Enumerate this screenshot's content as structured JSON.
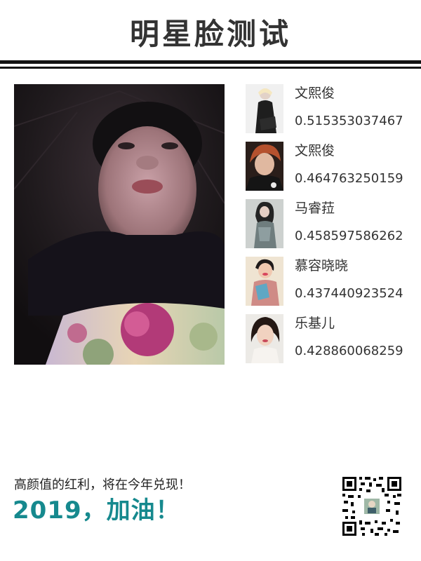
{
  "header": {
    "title": "明星脸测试"
  },
  "user_photo": {
    "icon": "user-face-photo"
  },
  "matches": [
    {
      "name": "文熙俊",
      "score": "0.515353037467",
      "bg": "#f2f2f2",
      "tone": "#2a2a2a"
    },
    {
      "name": "文熙俊",
      "score": "0.464763250159",
      "bg": "#3a2a24",
      "tone": "#c9b6a8"
    },
    {
      "name": "马睿菈",
      "score": "0.458597586262",
      "bg": "#cfd3d0",
      "tone": "#4c5a5c"
    },
    {
      "name": "慕容晓晓",
      "score": "0.437440923524",
      "bg": "#e9dcc9",
      "tone": "#d79b7a"
    },
    {
      "name": "乐基儿",
      "score": "0.428860068259",
      "bg": "#ececec",
      "tone": "#2b1f1b"
    }
  ],
  "footer": {
    "caption": "高颜值的红利，将在今年兑现！",
    "slogan": "2019，加油！",
    "qr_icon": "qr-code-icon"
  },
  "colors": {
    "accent": "#16898e",
    "title": "#333333",
    "rule": "#111111"
  }
}
